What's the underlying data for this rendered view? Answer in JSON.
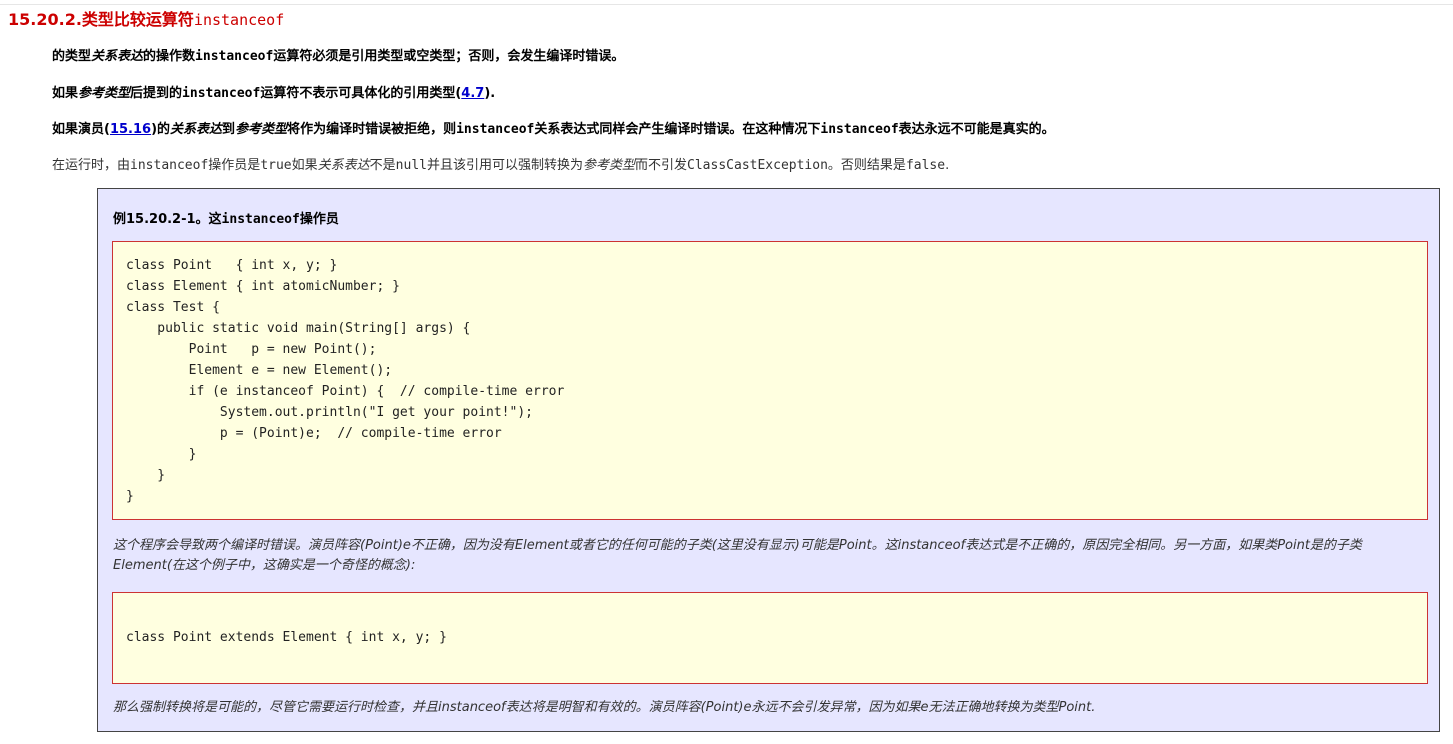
{
  "section": {
    "number": "15.20.2.",
    "title_cn": "类型比较运算符",
    "title_code": "instanceof"
  },
  "paragraphs": {
    "p1": {
      "a": "的类型",
      "b": "关系表达",
      "c": "的操作数",
      "d": "instanceof",
      "e": "运算符必须是引用类型或空类型；否则，会发生编译时错误。"
    },
    "p2": {
      "a": "如果",
      "b": "参考类型",
      "c": "后提到的",
      "d": "instanceof",
      "e": "运算符不表示可具体化的引用类型(",
      "link": "4.7",
      "f": ")."
    },
    "p3": {
      "a": "如果演员(",
      "link": "15.16",
      "b": ")的",
      "c": "关系表达",
      "d": "到",
      "e": "参考类型",
      "f": "将作为编译时错误被拒绝，则",
      "g": "instanceof",
      "h": "关系表达式同样会产生编译时错误。在这种情况下",
      "i": "instanceof",
      "j": "表达永远不可能是真实的。"
    },
    "p4": {
      "a": "在运行时，由",
      "b": "instanceof",
      "c": "操作员是",
      "d": "true",
      "e": "如果",
      "f": "关系表达",
      "g": "不是",
      "h": "null",
      "i": "并且该引用可以强制转换为",
      "j": "参考类型",
      "k": "而不引发",
      "l": "ClassCastException",
      "m": "。否则结果是",
      "n": "false",
      "o": "."
    }
  },
  "example": {
    "title_a": "例15.20.2-1。这",
    "title_b": "instanceof",
    "title_c": "操作员",
    "code1": "class Point   { int x, y; }\nclass Element { int atomicNumber; }\nclass Test {\n    public static void main(String[] args) {\n        Point   p = new Point();\n        Element e = new Element();\n        if (e instanceof Point) {  // compile-time error\n            System.out.println(\"I get your point!\");\n            p = (Point)e;  // compile-time error\n        }\n    }\n}",
    "note1": "这个程序会导致两个编译时错误。演员阵容(Point)e不正确，因为没有Element或者它的任何可能的子类(这里没有显示)可能是Point。这instanceof表达式是不正确的，原因完全相同。另一方面，如果类Point是的子类Element(在这个例子中，这确实是一个奇怪的概念):",
    "code2": "class Point extends Element { int x, y; }",
    "note2": "那么强制转换将是可能的，尽管它需要运行时检查，并且instanceof表达将是明智和有效的。演员阵容(Point)e永远不会引发异常，因为如果e无法正确地转换为类型Point."
  }
}
